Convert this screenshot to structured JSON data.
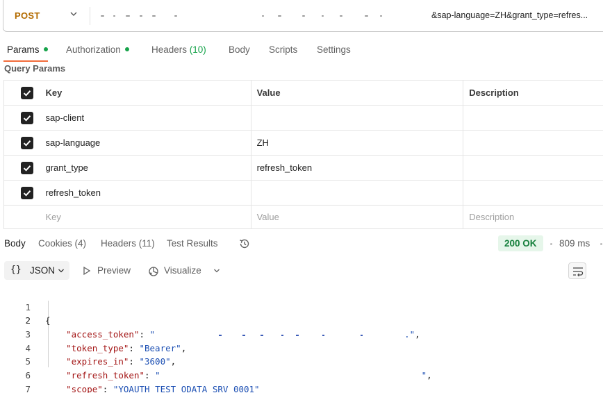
{
  "request": {
    "method": "POST",
    "url_visible": "&sap-language=ZH&grant_type=refres..."
  },
  "request_tabs": {
    "params": "Params",
    "authorization": "Authorization",
    "headers": "Headers",
    "headers_count": "(10)",
    "body": "Body",
    "scripts": "Scripts",
    "settings": "Settings"
  },
  "query_params": {
    "title": "Query Params",
    "headers": {
      "key": "Key",
      "value": "Value",
      "description": "Description"
    },
    "rows": [
      {
        "key": "sap-client",
        "value": "",
        "description": "",
        "checked": true
      },
      {
        "key": "sap-language",
        "value": "ZH",
        "description": "",
        "checked": true
      },
      {
        "key": "grant_type",
        "value": "refresh_token",
        "description": "",
        "checked": true
      },
      {
        "key": "refresh_token",
        "value": "",
        "description": "",
        "checked": true
      }
    ],
    "placeholder": {
      "key": "Key",
      "value": "Value",
      "description": "Description"
    }
  },
  "response_tabs": {
    "body": "Body",
    "cookies": "Cookies",
    "cookies_count": "(4)",
    "headers": "Headers",
    "headers_count": "(11)",
    "test_results": "Test Results"
  },
  "response_status": {
    "status": "200 OK",
    "time": "809 ms"
  },
  "response_toolbar": {
    "format": "JSON",
    "brace_icon": "{}",
    "preview": "Preview",
    "visualize": "Visualize"
  },
  "response_body": {
    "line_numbers": [
      "1",
      "2",
      "3",
      "4",
      "5",
      "6",
      "7"
    ],
    "open_brace": "{",
    "close_brace": "}",
    "access_token_key": "\"access_token\"",
    "token_type_key": "\"token_type\"",
    "token_type_value": "\"Bearer\"",
    "expires_in_key": "\"expires_in\"",
    "expires_in_value": "\"3600\"",
    "refresh_token_key": "\"refresh_token\"",
    "scope_key": "\"scope\"",
    "scope_value": "\"YOAUTH_TEST_ODATA_SRV_0001\""
  },
  "colors": {
    "method": "#b36b00",
    "active_tab_underline": "#f26b3a",
    "dot_green": "#16a34a",
    "status_bg": "#e6f6ea",
    "status_text": "#16803c",
    "json_key": "#a31515",
    "json_string": "#1c4fb3"
  },
  "icons": [
    "chevron-down-icon",
    "checkbox-checked-icon",
    "history-icon",
    "play-icon",
    "visualize-icon",
    "word-wrap-icon"
  ]
}
